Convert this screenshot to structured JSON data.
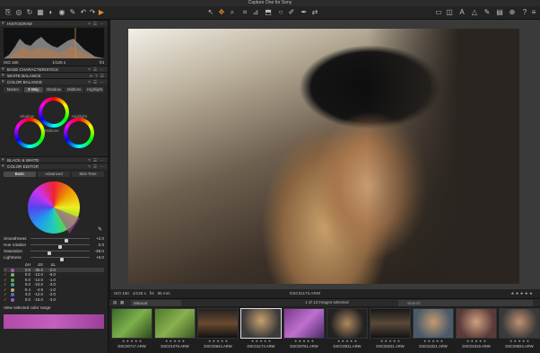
{
  "app": {
    "title": "Capture One for Sony"
  },
  "wb": {
    "r": "180",
    "g": "178",
    "b": "180",
    "k": "174"
  },
  "panels": {
    "histogram": "HISTOGRAM",
    "iso": "ISO 160",
    "shutter": "1/125 s",
    "aperture": "f/4",
    "base": "BASE CHARACTERISTICS",
    "wb": "WHITE BALANCE",
    "cb": "COLOR BALANCE",
    "cb_tabs": [
      "Master",
      "3-Way",
      "Shadow",
      "Midtone",
      "Highlight"
    ],
    "wheel_labels": {
      "shadow": "Shadow",
      "midtone": "Midtone",
      "highlight": "Highlight"
    },
    "bw": "BLACK & WHITE",
    "ce": "COLOR EDITOR",
    "ce_tabs": [
      "Basic",
      "Advanced",
      "Skin Tone"
    ]
  },
  "sliders": [
    {
      "label": "Smoothness",
      "value": "+2.0",
      "pos": 0.6
    },
    {
      "label": "Hue rotation",
      "value": "0.0",
      "pos": 0.5
    },
    {
      "label": "Saturation",
      "value": "-36.0",
      "pos": 0.32
    },
    {
      "label": "Lightness",
      "value": "+5.0",
      "pos": 0.53
    }
  ],
  "table": {
    "headers": [
      "ΔH",
      "ΔS",
      "ΔL"
    ],
    "rows": [
      {
        "h": "0.0",
        "s": "-36.0",
        "l": "-2.0",
        "color": "#b05ab0"
      },
      {
        "h": "0.0",
        "s": "-12.0",
        "l": "-5.0",
        "color": "#7ab06a"
      },
      {
        "h": "6.0",
        "s": "-14.0",
        "l": "-1.0",
        "color": "#55aa55"
      },
      {
        "h": "0.0",
        "s": "-24.0",
        "l": "-3.0",
        "color": "#48a0a0"
      },
      {
        "h": "-0.4",
        "l": "-1.0",
        "s": "-4.6",
        "color": "#d0a070"
      },
      {
        "h": "3.0",
        "s": "-12.0",
        "l": "-2.0",
        "color": "#3a7ac8"
      },
      {
        "h": "0.0",
        "s": "-15.0",
        "l": "-3.0",
        "color": "#9060c0"
      }
    ]
  },
  "view_range_label": "View selected color range",
  "viewer": {
    "iso": "ISO 160",
    "shutter": "1/125 s",
    "aperture": "f/4",
    "focal": "85 mm",
    "filename": "DSC01173.ARW"
  },
  "browser": {
    "filter": "Manual",
    "count": "1 of 13 images selected",
    "search": "Search"
  },
  "thumbnails": [
    "DSC00717.ARW",
    "DSC01079.ARW",
    "DSC00644.ARW",
    "DSC01173.ARW",
    "DSC00751.ARW",
    "DSC02911.ARW",
    "DSC00231.ARW",
    "DSC02221.ARW",
    "DSC02319.ARW",
    "DSC00834.ARW"
  ],
  "colors": {
    "accent": "#e08a2c",
    "wb": "#9fd86a"
  }
}
